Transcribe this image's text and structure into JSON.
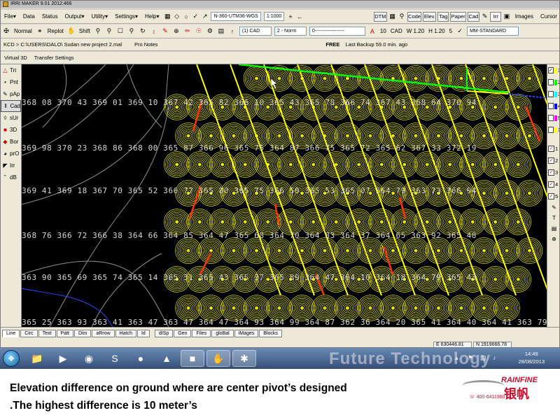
{
  "titlebar": {
    "title": "IRRI MAKER  9.01    2012:466"
  },
  "menu": {
    "items": [
      "File",
      "Data",
      "Status",
      "Output",
      "Utility",
      "Settings",
      "Help"
    ],
    "projection": "N-360-UTM36-WGS",
    "scale": "1:1000",
    "buttons": [
      "DTM",
      "Code",
      "Elev.",
      "Tag",
      "Paper",
      "Cad",
      "Irr"
    ],
    "images_label": "Images",
    "cursor_label": "Cursor"
  },
  "toolbar": {
    "normal": "Normal",
    "replot": "Replot",
    "shift": "Shift",
    "cad_combo": "(1) CAD",
    "norm_combo": "2 - Norm",
    "line_combo": "0------------------",
    "text_height": "10",
    "cad_label": "CAD",
    "w_value": "W 1.20",
    "h_value": "H 1.20",
    "h_num": "5",
    "font_combo": "MM-STANDARD"
  },
  "pathbar": {
    "path": "KCD > C:\\USERS\\DALO\\ Sudan new project 2.mal",
    "pro_notes": "Pro Notes",
    "free": "FREE",
    "backup": "Last Backup 59.0 min. ago"
  },
  "tabbar": {
    "tabs": [
      "Virtual 3D",
      "Transfer Settings"
    ]
  },
  "leftpanel": {
    "items": [
      {
        "label": "Tri",
        "icon": "triangle-icon"
      },
      {
        "label": "Pnt",
        "icon": "point-icon"
      },
      {
        "label": "pAp",
        "icon": "pap-icon"
      },
      {
        "label": "Cad",
        "icon": "cad-icon",
        "selected": true
      },
      {
        "label": "sUr",
        "icon": "surface-icon"
      },
      {
        "label": "3D",
        "icon": "cube-icon"
      },
      {
        "label": "Bor",
        "icon": "border-icon"
      },
      {
        "label": "prO",
        "icon": "profile-icon"
      },
      {
        "label": "Irr",
        "icon": "irrigation-icon"
      },
      {
        "label": "dB",
        "icon": "database-icon"
      }
    ]
  },
  "rightpanel": {
    "layers": [
      {
        "label": "1",
        "color": "#ffff00",
        "checked": true
      },
      {
        "label": "2",
        "color": "#00ff00",
        "checked": false
      },
      {
        "label": "3",
        "color": "#00ffff",
        "checked": false
      },
      {
        "label": "4",
        "color": "#0000ff",
        "checked": false
      },
      {
        "label": "5",
        "color": "#ff00ff",
        "checked": false
      },
      {
        "label": "1",
        "color": "#ffff00",
        "checked": false
      }
    ],
    "checks": [
      "1",
      "2",
      "3",
      "4",
      "5"
    ]
  },
  "canvas": {
    "rows": [
      {
        "text": "368 08 370 43 369 01 369 10 367 42 365 82 366 10 365 43 365 78 366 74 367 43 368 64 370 94"
      },
      {
        "text": "369 98 370 23 368 86 368 00 365 87 366 96 365 75 364 87 366 75 365 72 365 62 367 33 372 19"
      },
      {
        "text": "369 41 369 18 367 70 365 52 366 77 365 80 365 75 366 50 365 53 365 07 364 79 363 73 366 94"
      },
      {
        "text": "368 76 366 72 366 38 364 66 364 85 364 47 365 68 364 70 364 83 364 37 364 65 363 92 365 48"
      },
      {
        "text": "363 90 365 69 365 74 365 14 365 31 365 43 365 37 365 89 364 47 364 10 364 18 364 79 365 43"
      },
      {
        "text": "365 25 363 93 363 41 363 47 363 47 364 47 364 93 364 99 364 87 362 36 364 20 365 41 364 40 364 41 363 79"
      }
    ]
  },
  "bottombar": {
    "tabs": [
      "Line",
      "Circ",
      "Text",
      "Patt",
      "Dim",
      "aRrow",
      "Hatch",
      "Id",
      "dISp",
      "Gen",
      "Files",
      "gloBal",
      "iMages",
      "Blocks"
    ],
    "easting": "E 630446.81",
    "northing": "N 1919666.78"
  },
  "taskbar": {
    "watermark": "Future Technology",
    "time": "14:49",
    "date": "28/08/2013",
    "icons": [
      "folder-icon",
      "media-icon",
      "chrome-icon",
      "skype-icon",
      "earth-icon",
      "pdf-icon",
      "stamp-icon",
      "paint-icon",
      "irrimaker-icon"
    ]
  },
  "caption": {
    "line1": "Elevation difference on ground where are center pivot’s designed",
    "line2": ".The highest difference is 10 meter’s"
  },
  "logo": {
    "brand": "RAINFINE",
    "tel": "400-6411960"
  },
  "colors": {
    "canvas_bg": "#000000",
    "pivot": "#ffff00",
    "contour": "#8f8f8f",
    "high_slope": "#ff3300",
    "green_line": "#00ff00",
    "blue_line": "#3344ff"
  }
}
